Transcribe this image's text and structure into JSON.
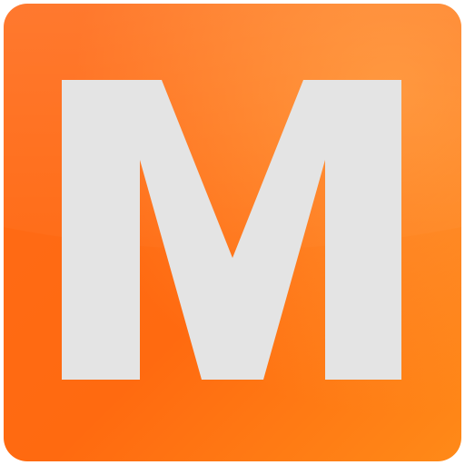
{
  "app_icon": {
    "letter": "M",
    "background_colors": [
      "#ff5a12",
      "#ff7a1a",
      "#ff9a2a"
    ],
    "letter_color": "#e4e4e4"
  }
}
